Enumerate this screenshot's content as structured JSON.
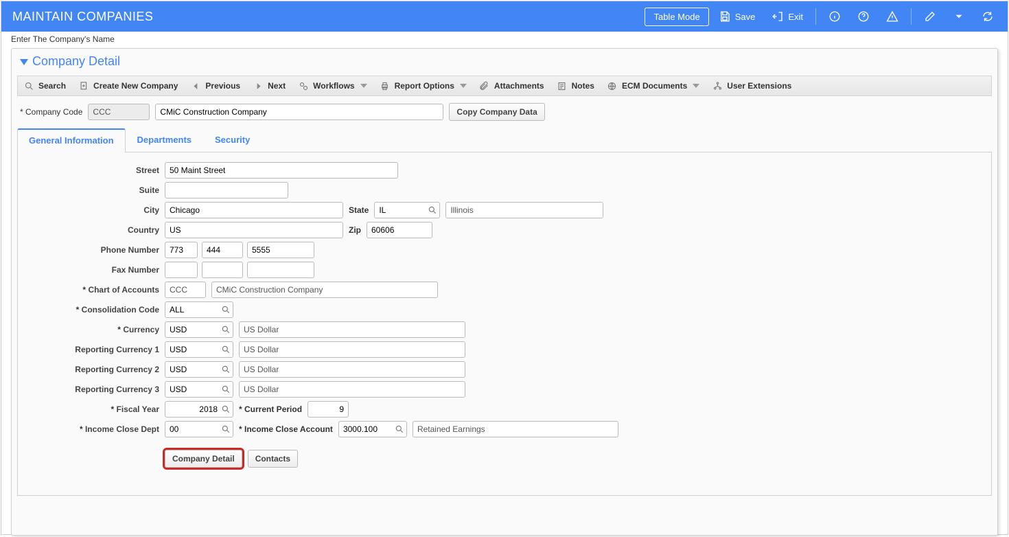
{
  "header": {
    "title": "MAINTAIN COMPANIES",
    "table_mode": "Table Mode",
    "save": "Save",
    "exit": "Exit"
  },
  "sub_header": "Enter The Company's Name",
  "panel": {
    "title": "Company Detail"
  },
  "toolbar": {
    "search": "Search",
    "create": "Create New Company",
    "previous": "Previous",
    "next": "Next",
    "workflows": "Workflows",
    "report_options": "Report Options",
    "attachments": "Attachments",
    "notes": "Notes",
    "ecm": "ECM Documents",
    "user_ext": "User Extensions"
  },
  "company": {
    "code_label": "Company Code",
    "code": "CCC",
    "name": "CMiC Construction Company",
    "copy_btn": "Copy Company Data"
  },
  "tabs": {
    "general": "General Information",
    "departments": "Departments",
    "security": "Security"
  },
  "form": {
    "street_label": "Street",
    "street": "50 Maint Street",
    "suite_label": "Suite",
    "suite": "",
    "city_label": "City",
    "city": "Chicago",
    "state_label": "State",
    "state": "IL",
    "state_name": "Illinois",
    "country_label": "Country",
    "country": "US",
    "zip_label": "Zip",
    "zip": "60606",
    "phone_label": "Phone Number",
    "phone1": "773",
    "phone2": "444",
    "phone3": "5555",
    "fax_label": "Fax Number",
    "fax1": "",
    "fax2": "",
    "fax3": "",
    "coa_label": "Chart of Accounts",
    "coa": "CCC",
    "coa_name": "CMiC Construction Company",
    "consol_label": "Consolidation Code",
    "consol": "ALL",
    "currency_label": "Currency",
    "currency": "USD",
    "currency_name": "US Dollar",
    "repcur1_label": "Reporting Currency 1",
    "repcur1": "USD",
    "repcur1_name": "US Dollar",
    "repcur2_label": "Reporting Currency 2",
    "repcur2": "USD",
    "repcur2_name": "US Dollar",
    "repcur3_label": "Reporting Currency 3",
    "repcur3": "USD",
    "repcur3_name": "US Dollar",
    "fiscal_label": "Fiscal Year",
    "fiscal": "2018",
    "period_label": "Current Period",
    "period": "9",
    "icd_label": "Income Close Dept",
    "icd": "00",
    "ica_label": "Income Close Account",
    "ica": "3000.100",
    "ica_name": "Retained Earnings"
  },
  "actions": {
    "company_detail": "Company Detail",
    "contacts": "Contacts"
  }
}
